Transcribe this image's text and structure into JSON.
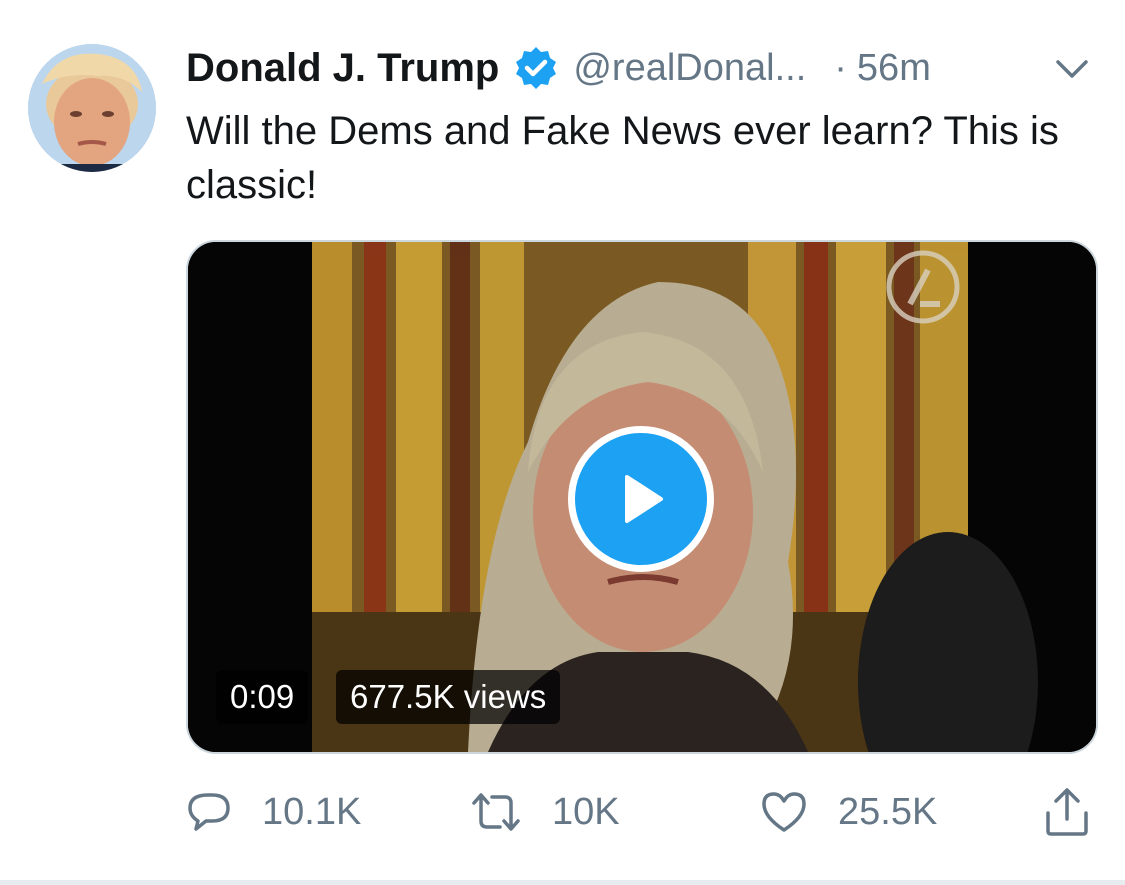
{
  "tweet": {
    "author": {
      "display_name": "Donald J. Trump",
      "handle": "@realDonal...",
      "verified": true,
      "avatar_icon": "user-avatar"
    },
    "separator": "·",
    "time": "56m",
    "text": "Will the Dems and Fake News ever learn? This is classic!",
    "media": {
      "type": "video",
      "duration": "0:09",
      "views": "677.5K views",
      "play_icon": "play-icon"
    },
    "actions": {
      "reply": {
        "count": "10.1K",
        "icon": "reply-icon"
      },
      "retweet": {
        "count": "10K",
        "icon": "retweet-icon"
      },
      "like": {
        "count": "25.5K",
        "icon": "heart-icon"
      },
      "share": {
        "icon": "share-icon"
      }
    },
    "menu_icon": "chevron-down-icon"
  },
  "colors": {
    "primary_text": "#14171a",
    "secondary_text": "#657786",
    "accent": "#1da1f2",
    "border": "#ccd6dd"
  }
}
